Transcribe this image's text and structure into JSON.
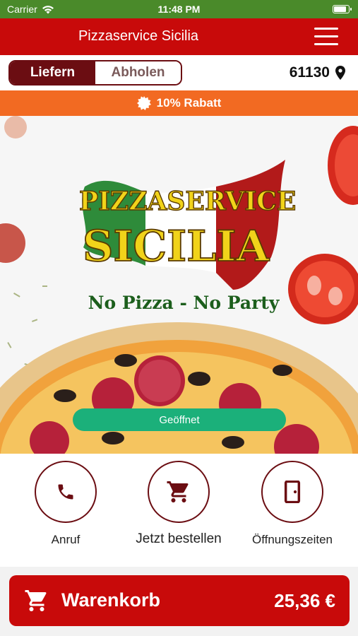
{
  "status_bar": {
    "carrier": "Carrier",
    "time": "11:48 PM"
  },
  "header": {
    "title": "Pizzaservice Sicilia"
  },
  "mode_toggle": {
    "deliver": "Liefern",
    "pickup": "Abholen"
  },
  "location": {
    "zip": "61130"
  },
  "promo": {
    "text": "10% Rabatt"
  },
  "hero": {
    "logo_line1": "Pizzaservice",
    "logo_line2": "Sicilia",
    "slogan": "No Pizza - No Party",
    "status": "Geöffnet"
  },
  "actions": {
    "call": "Anruf",
    "order": "Jetzt bestellen",
    "hours": "Öffnungszeiten"
  },
  "cart": {
    "label": "Warenkorb",
    "total": "25,36 €"
  },
  "colors": {
    "brand_red": "#c80a0a",
    "dark_red": "#6b0d12",
    "promo_orange": "#f26a22",
    "open_green": "#1bb07a",
    "status_green": "#4a8a2a"
  }
}
